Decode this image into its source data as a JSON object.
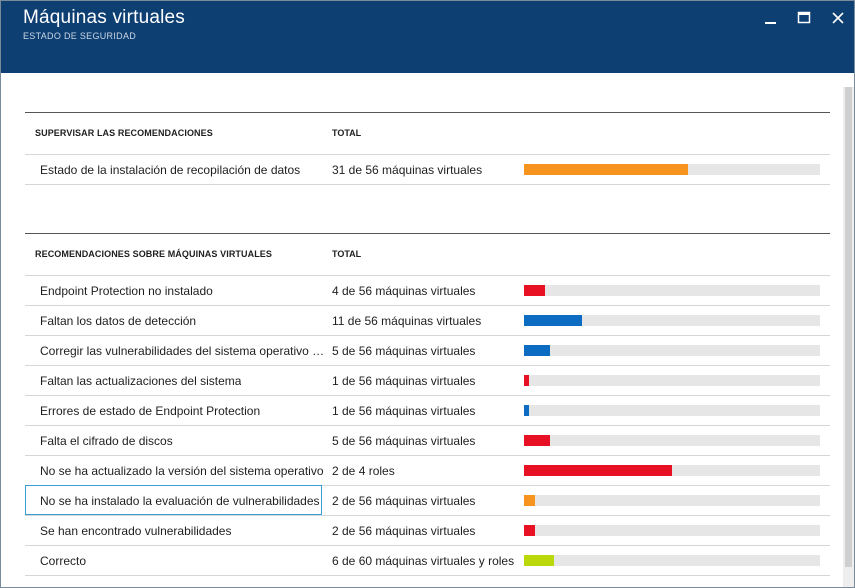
{
  "window": {
    "title": "Máquinas virtuales",
    "subtitle": "ESTADO DE SEGURIDAD"
  },
  "colors": {
    "titlebar": "#0e3f73",
    "orange": "#f7941d",
    "red": "#e81123",
    "blue": "#0b6cc2",
    "lime": "#bad80a",
    "track": "#e6e6e6"
  },
  "sections": [
    {
      "header_name": "SUPERVISAR LAS RECOMENDACIONES",
      "header_total": "TOTAL",
      "rows": [
        {
          "name": "Estado de la instalación de recopilación de datos",
          "total": "31 de 56 máquinas virtuales",
          "fraction": 0.554,
          "color": "#f7941d"
        }
      ]
    },
    {
      "header_name": "RECOMENDACIONES SOBRE MÁQUINAS VIRTUALES",
      "header_total": "TOTAL",
      "rows": [
        {
          "name": "Endpoint Protection no instalado",
          "total": "4 de 56 máquinas virtuales",
          "fraction": 0.071,
          "color": "#e81123"
        },
        {
          "name": "Faltan los datos de detección",
          "total": "11 de 56 máquinas virtuales",
          "fraction": 0.196,
          "color": "#0b6cc2"
        },
        {
          "name": "Corregir las vulnerabilidades del sistema operativo (de Microsoft)",
          "total": "5 de 56 máquinas virtuales",
          "fraction": 0.089,
          "color": "#0b6cc2"
        },
        {
          "name": "Faltan las actualizaciones del sistema",
          "total": "1 de 56 máquinas virtuales",
          "fraction": 0.018,
          "color": "#e81123"
        },
        {
          "name": "Errores de estado de Endpoint Protection",
          "total": "1 de 56 máquinas virtuales",
          "fraction": 0.018,
          "color": "#0b6cc2"
        },
        {
          "name": "Falta el cifrado de discos",
          "total": "5 de 56 máquinas virtuales",
          "fraction": 0.089,
          "color": "#e81123"
        },
        {
          "name": "No se ha actualizado la versión del sistema operativo",
          "total": "2 de 4 roles",
          "fraction": 0.5,
          "color": "#e81123"
        },
        {
          "name": "No se ha instalado la evaluación de vulnerabilidades",
          "total": "2 de 56 máquinas virtuales",
          "fraction": 0.036,
          "color": "#f7941d",
          "selected": true
        },
        {
          "name": "Se han encontrado vulnerabilidades",
          "total": "2 de 56 máquinas virtuales",
          "fraction": 0.036,
          "color": "#e81123"
        },
        {
          "name": "Correcto",
          "total": "6 de 60 máquinas virtuales y roles",
          "fraction": 0.1,
          "color": "#bad80a"
        }
      ]
    }
  ]
}
